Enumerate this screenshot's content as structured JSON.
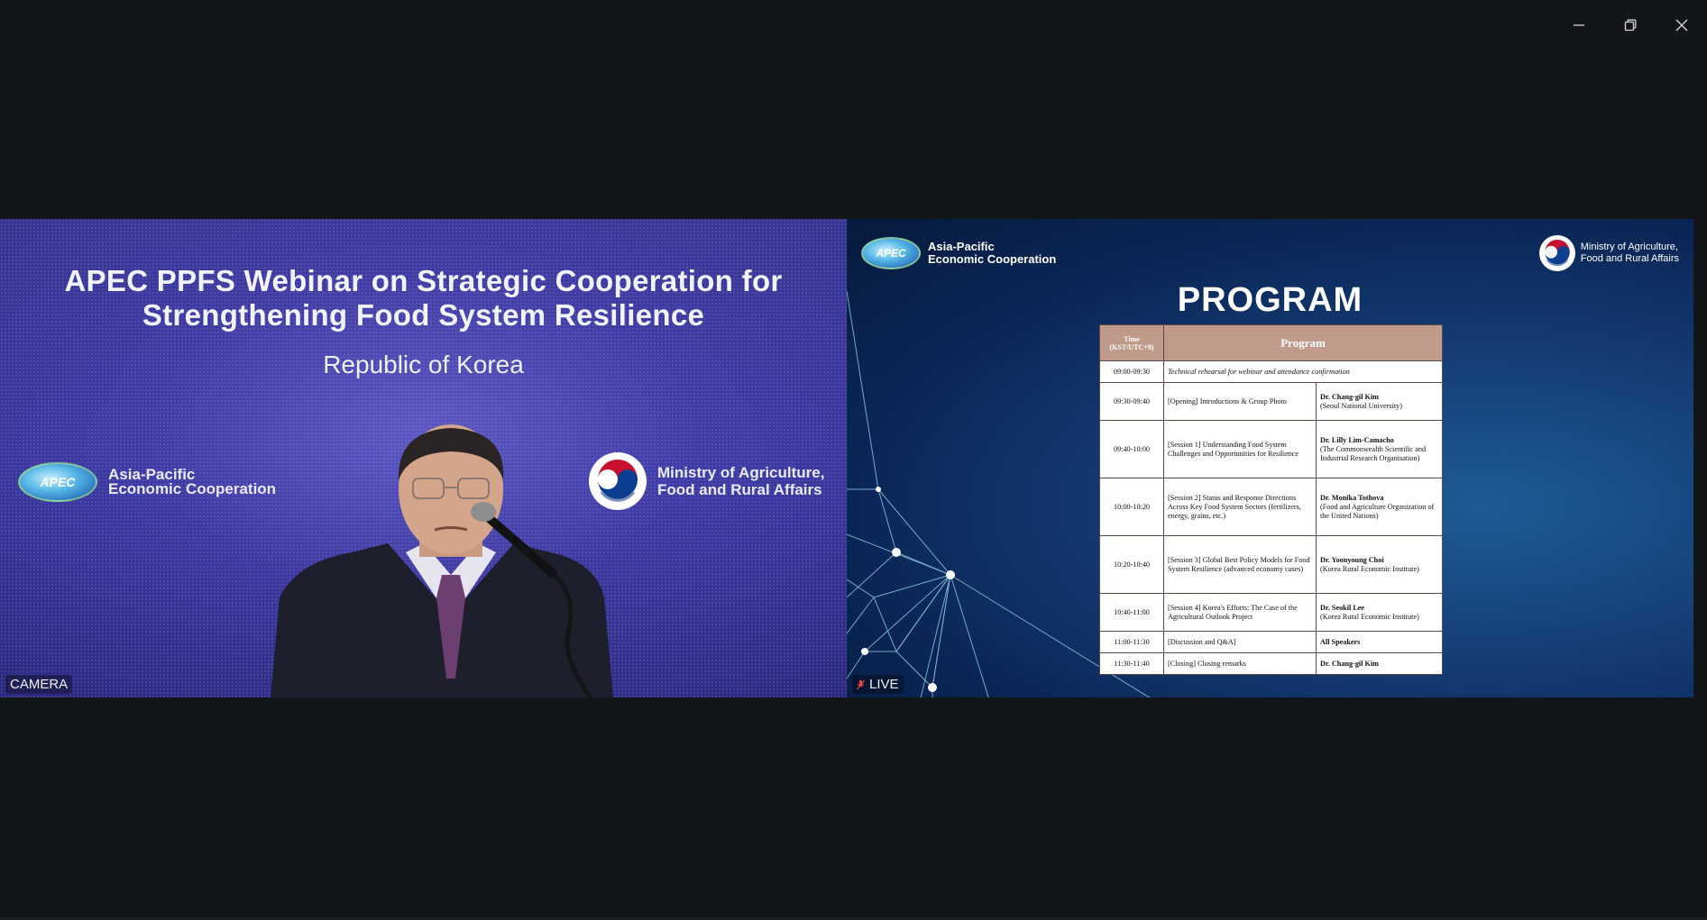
{
  "window": {
    "controls": [
      {
        "name": "minimize",
        "icon": "minimize-icon"
      },
      {
        "name": "restore",
        "icon": "restore-icon"
      },
      {
        "name": "close",
        "icon": "close-icon"
      }
    ]
  },
  "camera_feed": {
    "label": "CAMERA",
    "title_line1": "APEC PPFS Webinar on Strategic Cooperation for",
    "title_line2": "Strengthening Food System Resilience",
    "subtitle": "Republic of Korea",
    "apec_logo_text": "APEC",
    "apec_line1": "Asia-Pacific",
    "apec_line2": "Economic Cooperation",
    "ministry_line1": "Ministry of Agriculture,",
    "ministry_line2": "Food and Rural Affairs"
  },
  "slide_feed": {
    "label": "LIVE",
    "apec_logo_text": "APEC",
    "apec_line1": "Asia-Pacific",
    "apec_line2": "Economic Cooperation",
    "ministry_line1": "Ministry of Agriculture,",
    "ministry_line2": "Food and Rural Affairs",
    "heading": "PROGRAM",
    "table": {
      "header_time_line1": "Time",
      "header_time_line2": "(KST/UTC+9)",
      "header_program": "Program",
      "rows": [
        {
          "time": "09:00-09:30",
          "program": "Technical rehearsal for webinar and attendance confirmation",
          "speaker_name": "",
          "speaker_org": ""
        },
        {
          "time": "09:30-09:40",
          "program": "[Opening] Introductions & Group Photo",
          "speaker_name": "Dr. Chang-gil Kim",
          "speaker_org": "(Seoul National University)"
        },
        {
          "time": "09:40-10:00",
          "program": "[Session 1] Understanding Food System Challenges and Opportunities for Resilience",
          "speaker_name": "Dr. Lilly Lim-Camacho",
          "speaker_org": "(The Commonwealth Scientific and Industrial Research Organisation)"
        },
        {
          "time": "10:00-10:20",
          "program": "[Session 2] Status and Response Directions Across Key Food System Sectors (fertilizers, energy, grains, etc.)",
          "speaker_name": "Dr. Monika Tothova",
          "speaker_org": "(Food and Agriculture Organization of the United Nations)"
        },
        {
          "time": "10:20-10:40",
          "program": "[Session 3] Global Best Policy Models for Food System Resilience (advanced economy cases)",
          "speaker_name": "Dr. Yoonyoung Choi",
          "speaker_org": "(Korea Rural Economic Institute)"
        },
        {
          "time": "10:40-11:00",
          "program": "[Session 4] Korea's Efforts: The Case of the Agricultural Outlook Project",
          "speaker_name": "Dr. Seokil Lee",
          "speaker_org": "(Korea Rural Economic Institute)"
        },
        {
          "time": "11:00-11:30",
          "program": "[Discussion and Q&A]",
          "speaker_name": "All Speakers",
          "speaker_org": ""
        },
        {
          "time": "11:30-11:40",
          "program": "[Closing] Closing remarks",
          "speaker_name": "Dr. Chang-gil Kim",
          "speaker_org": ""
        }
      ]
    }
  }
}
